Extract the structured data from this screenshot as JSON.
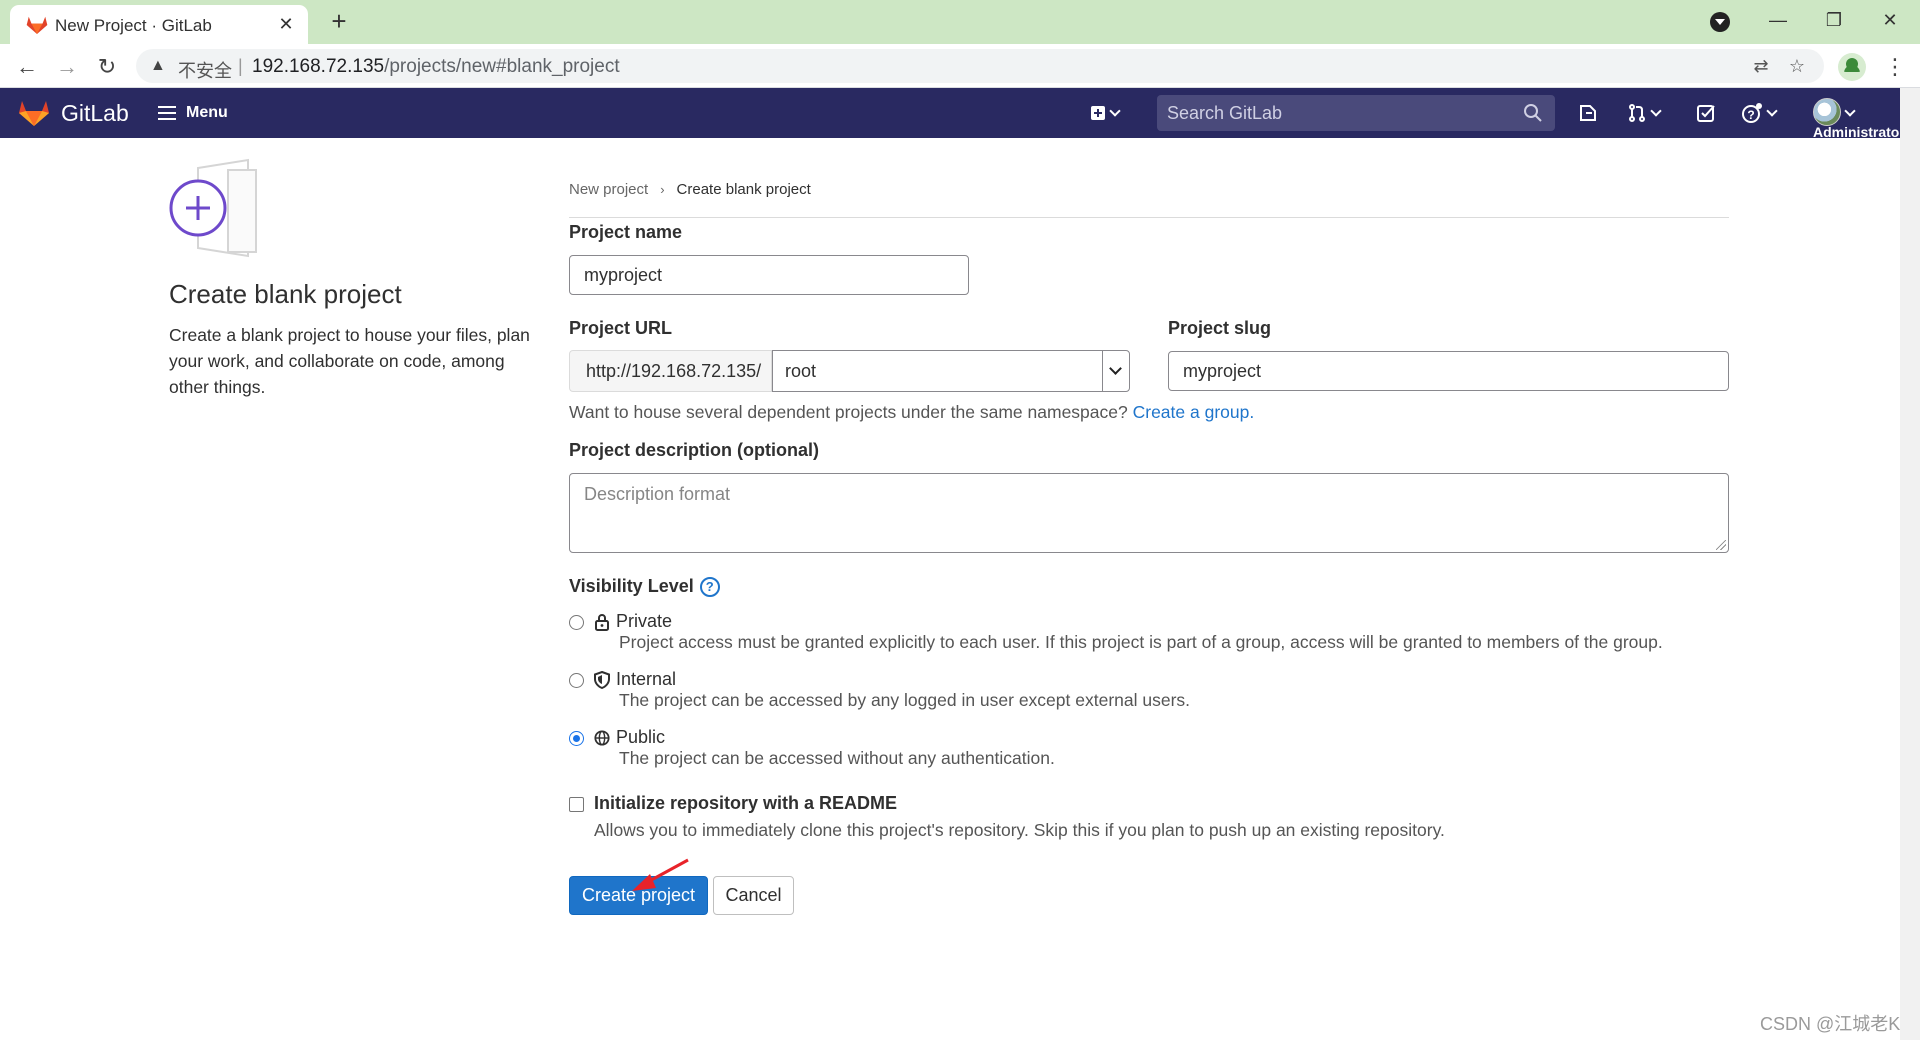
{
  "browser": {
    "tab_title": "New Project · GitLab",
    "insecure_label": "不安全",
    "url_host": "192.168.72.135",
    "url_path": "/projects/new#blank_project"
  },
  "header": {
    "brand": "GitLab",
    "menu_label": "Menu",
    "search_placeholder": "Search GitLab",
    "user_label": "Administrator"
  },
  "intro": {
    "title": "Create blank project",
    "description": "Create a blank project to house your files, plan your work, and collaborate on code, among other things."
  },
  "breadcrumb": {
    "parent": "New project",
    "current": "Create blank project"
  },
  "form": {
    "project_name_label": "Project name",
    "project_name_value": "myproject",
    "project_url_label": "Project URL",
    "url_prefix": "http://192.168.72.135/",
    "namespace_value": "root",
    "project_slug_label": "Project slug",
    "project_slug_value": "myproject",
    "namespace_help": "Want to house several dependent projects under the same namespace?",
    "create_group_link": "Create a group.",
    "description_label": "Project description (optional)",
    "description_placeholder": "Description format",
    "visibility_label": "Visibility Level",
    "visibility_options": [
      {
        "name": "Private",
        "description": "Project access must be granted explicitly to each user. If this project is part of a group, access will be granted to members of the group.",
        "selected": false
      },
      {
        "name": "Internal",
        "description": "The project can be accessed by any logged in user except external users.",
        "selected": false
      },
      {
        "name": "Public",
        "description": "The project can be accessed without any authentication.",
        "selected": true
      }
    ],
    "readme_label": "Initialize repository with a README",
    "readme_description": "Allows you to immediately clone this project's repository. Skip this if you plan to push up an existing repository.",
    "readme_checked": false,
    "create_button": "Create project",
    "cancel_button": "Cancel"
  },
  "watermark": "CSDN @江城老K",
  "colors": {
    "header_bg": "#292961",
    "primary": "#1f75cb",
    "tabstrip": "#cde7c4"
  }
}
